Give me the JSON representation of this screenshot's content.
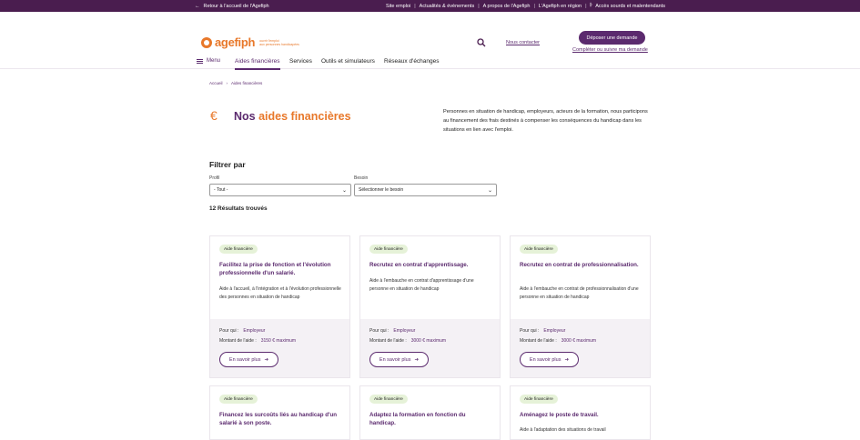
{
  "topbar": {
    "back": "Retour à l'accueil de l'Agefiph",
    "links": [
      "Site emploi",
      "Actualités & évènements",
      "A propos de l'Agefiph",
      "L'Agefiph en région",
      "Accès sourds et malentendants"
    ]
  },
  "header": {
    "logo_word": "agefiph",
    "logo_tag_1": "ouvrir l'emploi",
    "logo_tag_2": "aux personnes handicapées",
    "contact": "Nous contacter",
    "cta": "Déposer une demande",
    "follow": "Compléter ou suivre ma demande"
  },
  "nav": {
    "menu": "Menu",
    "items": [
      "Aides financières",
      "Services",
      "Outils et simulateurs",
      "Réseaux d'échanges"
    ]
  },
  "breadcrumb": {
    "home": "Accueil",
    "current": "Aides financières"
  },
  "hero": {
    "title_prefix": "Nos ",
    "title_highlight": "aides financières",
    "intro": "Personnes en situation de handicap, employeurs, acteurs de la formation, nous participons au financement des frais destinés à compenser les conséquences du handicap dans les situations en lien avec l'emploi."
  },
  "filter": {
    "title": "Filtrer par",
    "profile_label": "Profil",
    "profile_value": "- Tout -",
    "need_label": "Besoin",
    "need_value": "Sélectionner le besoin"
  },
  "results_count": "12 Résultats trouvés",
  "cards": [
    {
      "badge": "Aide financière",
      "title": "Facilitez la prise de fonction et l'évolution professionnelle d'un salarié.",
      "desc": "Aide à l'accueil, à l'intégration et à l'évolution professionnelle des personnes en situation de handicap",
      "who_label": "Pour qui :",
      "who": "Employeur",
      "amount_label": "Montant de l'aide :",
      "amount": "3150 € maximum",
      "more": "En savoir plus"
    },
    {
      "badge": "Aide financière",
      "title": "Recrutez en contrat d'apprentissage.",
      "desc": "Aide à l'embauche en contrat d'apprentissage d'une personne en situation de handicap",
      "who_label": "Pour qui :",
      "who": "Employeur",
      "amount_label": "Montant de l'aide :",
      "amount": "3000 € maximum",
      "more": "En savoir plus"
    },
    {
      "badge": "Aide financière",
      "title": "Recrutez en contrat de professionnalisation.",
      "desc": "Aide à l'embauche en contrat de professionnalisation d'une personne en situation de handicap",
      "who_label": "Pour qui :",
      "who": "Employeur",
      "amount_label": "Montant de l'aide :",
      "amount": "3000 € maximum",
      "more": "En savoir plus"
    },
    {
      "badge": "Aide financière",
      "title": "Financez les surcoûts liés au handicap d'un salarié à son poste."
    },
    {
      "badge": "Aide financière",
      "title": "Adaptez la formation en fonction du handicap."
    },
    {
      "badge": "Aide financière",
      "title": "Aménagez le poste de travail.",
      "desc": "Aide à l'adaptation des situations de travail"
    }
  ]
}
